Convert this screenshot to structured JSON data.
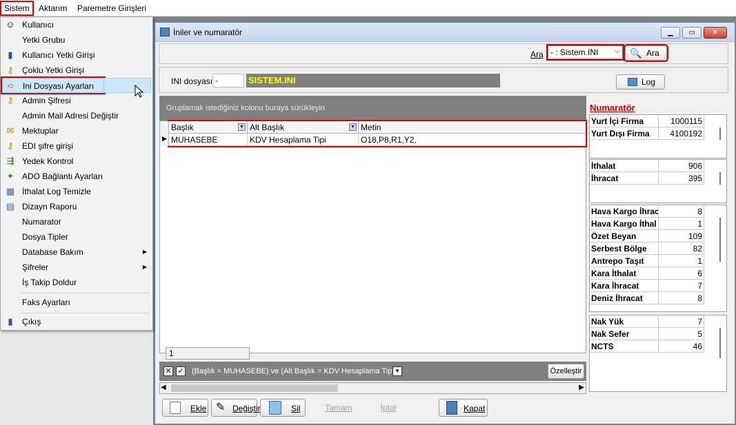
{
  "menubar": {
    "items": [
      "Sistem",
      "Aktarım",
      "Paremetre Girişleri"
    ]
  },
  "menu": {
    "items": [
      {
        "label": "Kullanıcı",
        "icon": "user-icon"
      },
      {
        "label": "Yetki Grubu",
        "icon": ""
      },
      {
        "label": "Kullanıcı Yetki Girişi",
        "icon": "user-permission-icon"
      },
      {
        "label": "Çoklu Yetki Girişi",
        "icon": "key-icon"
      },
      {
        "label": "Ini Dosyası  Ayarları",
        "icon": "file-settings-icon"
      },
      {
        "label": "Admin Şifresi",
        "icon": "key-icon"
      },
      {
        "label": "Admin Mail Adresi Değiştir",
        "icon": ""
      },
      {
        "label": "Mektuplar",
        "icon": "letter-icon"
      },
      {
        "label": "EDI şifre girişi",
        "icon": "key-icon"
      },
      {
        "label": "Yedek Kontrol",
        "icon": "backup-icon"
      },
      {
        "label": "ADO Bağlantı Ayarları",
        "icon": "connection-icon"
      },
      {
        "label": "İthalat Log Temizle",
        "icon": "log-clean-icon"
      },
      {
        "label": "Dizayn Raporu",
        "icon": "report-icon"
      },
      {
        "label": "Numarator",
        "icon": ""
      },
      {
        "label": "Dosya Tipler",
        "icon": ""
      },
      {
        "label": "Database Bakım",
        "icon": "",
        "submenu": true
      },
      {
        "label": "Şifreler",
        "icon": "",
        "submenu": true
      },
      {
        "label": "İş Takip Doldur",
        "icon": ""
      },
      {
        "label": "Faks Ayarları",
        "icon": ""
      },
      {
        "label": "Çıkış",
        "icon": "exit-icon"
      }
    ]
  },
  "window": {
    "title": "İniler ve numaratör",
    "search_label": "Ara",
    "search_value": "- : Sistem.INI",
    "search_button": "Ara",
    "ini_label": "INI dosyası",
    "ini_code": "-",
    "ini_name": "SISTEM.INI",
    "log_button": "Log"
  },
  "grid": {
    "group_hint": "Gruplamak istediğiniz kolonu buraya sürükleyin",
    "columns": [
      "Başlık",
      "Alt Başlık",
      "Metin"
    ],
    "rows": [
      [
        "MUHASEBE",
        "KDV Hesaplama Tipi",
        "O18,P8,R1,Y2,"
      ]
    ],
    "footer_count": "1",
    "filter_text": "(Başlık = MUHASEBE) ve (Alt Başlık = KDV Hesaplama Tipi)",
    "customize_button": "Özelleştir"
  },
  "numarator": {
    "title": "Numaratör",
    "groups": [
      [
        {
          "label": "Yurt İçi Firma",
          "value": "1000115"
        },
        {
          "label": "Yurt Dışı Firma",
          "value": "4100192"
        }
      ],
      [
        {
          "label": "İthalat",
          "value": "906"
        },
        {
          "label": "İhracat",
          "value": "395"
        }
      ],
      [
        {
          "label": "Hava Kargo İhrac",
          "value": "8"
        },
        {
          "label": "Hava Kargo İthal",
          "value": "1"
        },
        {
          "label": "Özet Beyan",
          "value": "109"
        },
        {
          "label": "Serbest Bölge",
          "value": "82"
        },
        {
          "label": "Antrepo Taşıt",
          "value": "1"
        },
        {
          "label": "Kara İthalat",
          "value": "6"
        },
        {
          "label": "Kara İhracat",
          "value": "7"
        },
        {
          "label": "Deniz İhracat",
          "value": "8"
        }
      ],
      [
        {
          "label": "Nak Yük",
          "value": "7"
        },
        {
          "label": "Nak Sefer",
          "value": "5"
        },
        {
          "label": "NCTS",
          "value": "46"
        }
      ]
    ]
  },
  "buttons": {
    "ekle": "Ekle",
    "degistir": "Değiştir",
    "sil": "Sil",
    "tamam": "Tamam",
    "iptal": "İptal",
    "kapat": "Kapat"
  }
}
